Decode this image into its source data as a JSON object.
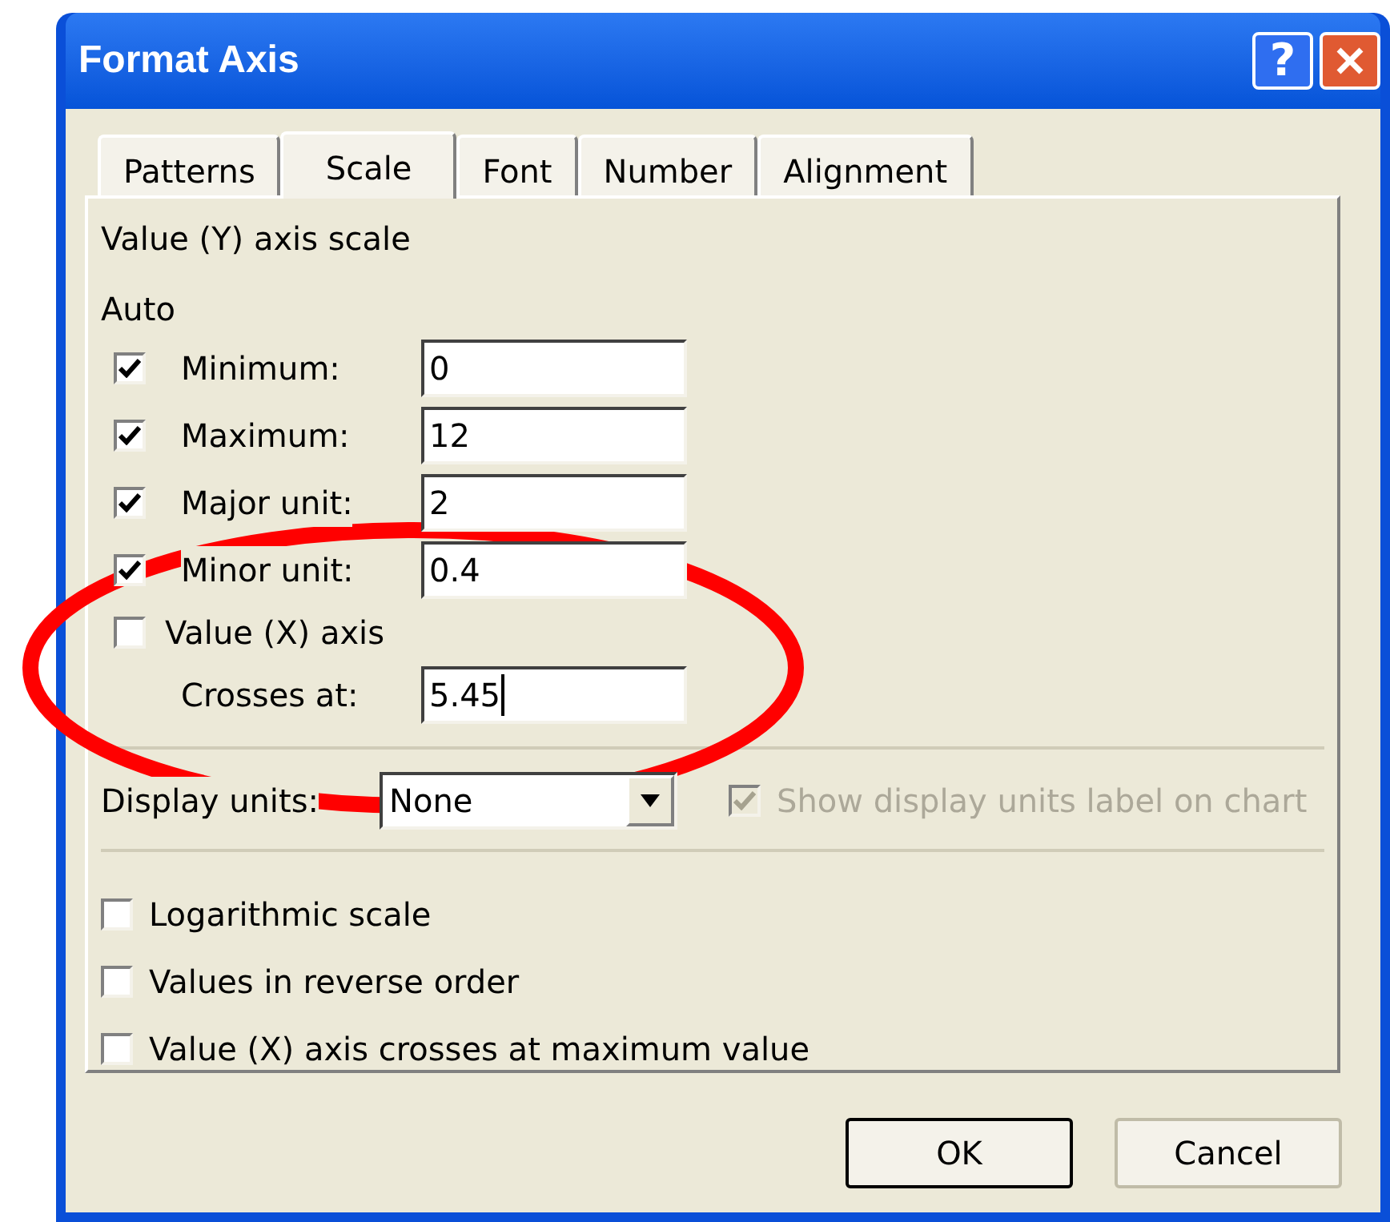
{
  "window": {
    "title": "Format Axis",
    "help": "?"
  },
  "tabs": [
    {
      "label": "Patterns",
      "selected": false
    },
    {
      "label": "Scale",
      "selected": true
    },
    {
      "label": "Font",
      "selected": false
    },
    {
      "label": "Number",
      "selected": false
    },
    {
      "label": "Alignment",
      "selected": false
    }
  ],
  "section_title": "Value (Y) axis scale",
  "auto_label": "Auto",
  "auto_rows": [
    {
      "label": "Minimum:",
      "checked": true,
      "value": "0"
    },
    {
      "label": "Maximum:",
      "checked": true,
      "value": "12"
    },
    {
      "label": "Major unit:",
      "checked": true,
      "value": "2"
    },
    {
      "label": "Minor unit:",
      "checked": true,
      "value": "0.4"
    }
  ],
  "value_x_axis": {
    "label": "Value (X) axis",
    "checked": false
  },
  "crosses_at": {
    "label": "Crosses at:",
    "value": "5.45"
  },
  "display_units": {
    "label": "Display units:",
    "value": "None",
    "show_label": {
      "label": "Show display units label on chart",
      "checked": true,
      "disabled": true
    }
  },
  "options": [
    {
      "label": "Logarithmic scale",
      "checked": false
    },
    {
      "label": "Values in reverse order",
      "checked": false
    },
    {
      "label": "Value (X) axis crosses at maximum value",
      "checked": false
    }
  ],
  "buttons": [
    {
      "label": "OK",
      "default": true
    },
    {
      "label": "Cancel",
      "default": false
    }
  ]
}
